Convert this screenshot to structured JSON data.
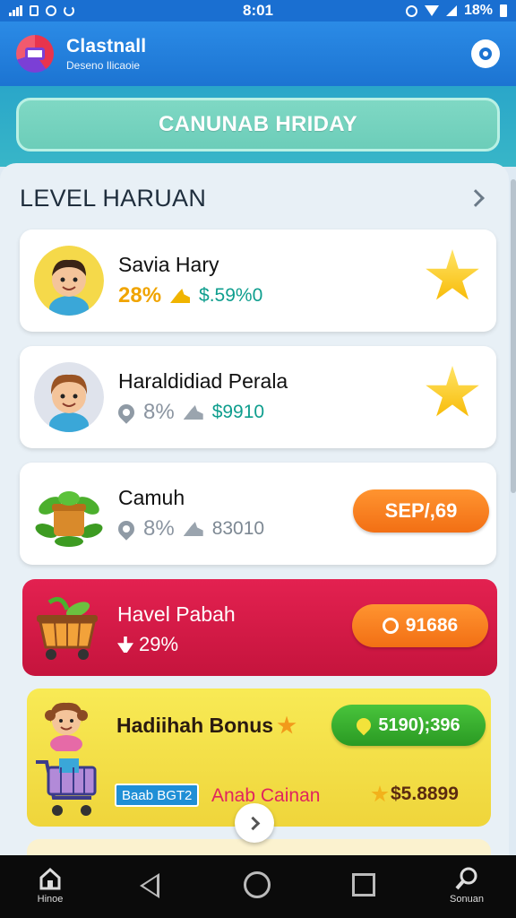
{
  "status_bar": {
    "time": "8:01",
    "battery": "18%"
  },
  "app_bar": {
    "title": "Clastnall",
    "subtitle": "Deseno Ilicaoie",
    "logo_icon": "app-logo",
    "action_icon": "profile-icon"
  },
  "banner": {
    "label": "CANUNAB HRIDAY"
  },
  "section": {
    "title": "LEVEL HARUAN"
  },
  "cards": [
    {
      "title": "Savia Hary",
      "percent": "28%",
      "amount": "$.59%0",
      "percent_color": "#f0a400",
      "amount_color": "#0f9e8e",
      "badge_icon": "star-icon"
    },
    {
      "title": "Haraldidiad Perala",
      "percent": "8%",
      "amount": "$9910",
      "percent_color": "#8a94a0",
      "amount_color": "#0f9e8e",
      "badge_icon": "star-icon"
    },
    {
      "title": "Camuh",
      "percent": "8%",
      "amount": "83010",
      "percent_color": "#8a94a0",
      "amount_color": "#7d8893",
      "button": "SEP/,69",
      "button_color": "#f57c1f"
    }
  ],
  "promo": {
    "title": "Havel Pabah",
    "percent": "29%",
    "button": "91686",
    "button_color": "#f57c1f"
  },
  "bonus": {
    "title": "Hadiihah Bonus",
    "button": "5190);396",
    "button_color": "#2fa52b",
    "tag": "Baab BGT2",
    "subtitle": "Anab Cainan",
    "amount": "$5.8899"
  },
  "nav": {
    "home_label": "Hinoe",
    "search_label": "Sonuan"
  }
}
